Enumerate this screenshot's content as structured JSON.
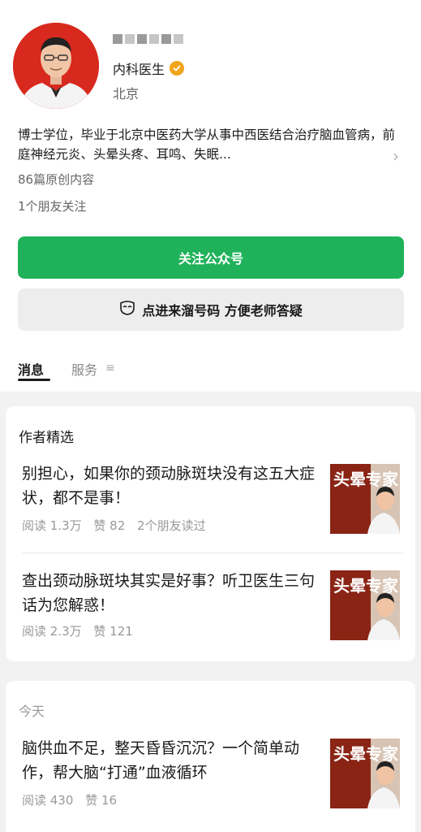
{
  "profile": {
    "name_hidden": "",
    "subtitle": "内科医生",
    "location": "北京",
    "bio": "博士学位，毕业于北京中医药大学从事中西医结合治疗脑血管病，前庭神经元炎、头晕头疼、耳鸣、失眠...",
    "original_count": "86篇原创内容",
    "friends_following": "1个朋友关注"
  },
  "actions": {
    "follow_label": "关注公众号",
    "bind_label": "点进来溜号码 方便老师答疑"
  },
  "tabs": [
    {
      "label": "消息"
    },
    {
      "label": "服务"
    }
  ],
  "featured": {
    "title": "作者精选",
    "articles": [
      {
        "title": "别担心，如果你的颈动脉斑块没有这五大症状，都不是事！",
        "reads": "阅读 1.3万",
        "likes": "赞 82",
        "friends": "2个朋友读过"
      },
      {
        "title": "查出颈动脉斑块其实是好事？听卫医生三句话为您解惑！",
        "reads": "阅读 2.3万",
        "likes": "赞 121"
      }
    ]
  },
  "today": {
    "label": "今天",
    "articles": [
      {
        "title": "脑供血不足，整天昏昏沉沉？一个简单动作，帮大脑“打通”血液循环",
        "reads": "阅读 430",
        "likes": "赞 16"
      }
    ]
  },
  "thumbnail_text": "头晕专家",
  "colors": {
    "accent_green": "#1fb25a",
    "verified_badge": "#f0a51b",
    "avatar_bg": "#d8291e"
  },
  "icons": {
    "verified": "verified-badge-icon",
    "chevron": "chevron-right-icon",
    "bind": "mask-icon",
    "menu": "menu-lines-icon"
  }
}
